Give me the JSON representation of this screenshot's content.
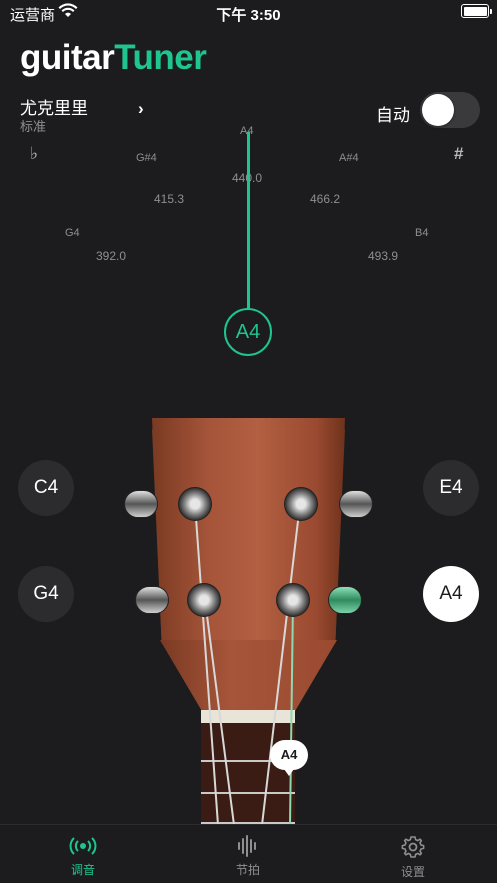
{
  "status_bar": {
    "carrier": "运营商",
    "time": "下午 3:50"
  },
  "header": {
    "title_part1": "guitar",
    "title_part2": "Tuner",
    "accent_color": "#1ec58e"
  },
  "instrument": {
    "name": "尤克里里",
    "tuning": "标准"
  },
  "auto_toggle": {
    "label": "自动",
    "enabled": false
  },
  "gauge": {
    "flat_symbol": "♭",
    "sharp_symbol": "#",
    "notes": [
      {
        "note": "G4",
        "freq": "392.0"
      },
      {
        "note": "G#4",
        "freq": "415.3"
      },
      {
        "note": "A4",
        "freq": "440.0"
      },
      {
        "note": "A#4",
        "freq": "466.2"
      },
      {
        "note": "B4",
        "freq": "493.9"
      }
    ],
    "current_note": "A4"
  },
  "strings": {
    "left": [
      {
        "label": "C4"
      },
      {
        "label": "G4"
      }
    ],
    "right": [
      {
        "label": "E4"
      },
      {
        "label": "A4",
        "selected": true
      }
    ],
    "active_marker": "A4"
  },
  "tabbar": {
    "items": [
      {
        "label": "调音",
        "icon": "tuning-signal-icon",
        "active": true
      },
      {
        "label": "节拍",
        "icon": "metronome-wave-icon",
        "active": false
      },
      {
        "label": "设置",
        "icon": "gear-icon",
        "active": false
      }
    ]
  }
}
